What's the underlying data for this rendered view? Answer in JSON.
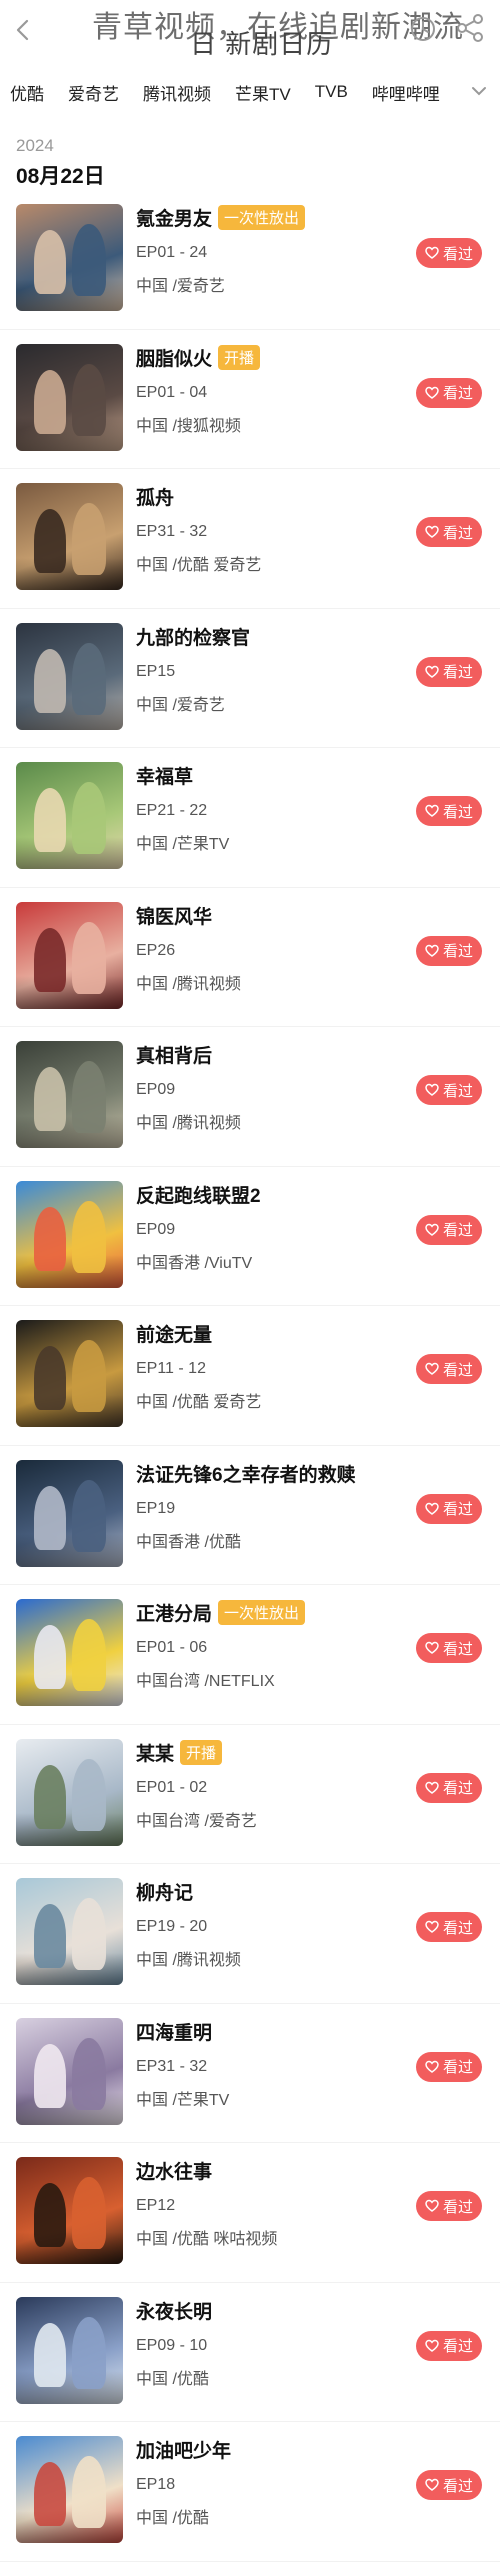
{
  "watermark": "青草视频，在线追剧新潮流",
  "header": {
    "title": "日 新剧日历"
  },
  "tabs": [
    "优酷",
    "爱奇艺",
    "腾讯视频",
    "芒果TV",
    "TVB",
    "哔哩哔哩"
  ],
  "year": "2024",
  "date": "08月22日",
  "watch_label": "看过",
  "items": [
    {
      "title": "氪金男友",
      "badge": "一次性放出",
      "episodes": "EP01 - 24",
      "region": "中国 /爱奇艺",
      "colors": [
        "#b98a6a",
        "#3c5a7a",
        "#d8c0a8"
      ]
    },
    {
      "title": "胭脂似火",
      "badge": "开播",
      "episodes": "EP01 - 04",
      "region": "中国 /搜狐视频",
      "colors": [
        "#2a2a2e",
        "#5a4a44",
        "#c9a890"
      ]
    },
    {
      "title": "孤舟",
      "badge": "",
      "episodes": "EP31 - 32",
      "region": "中国 /优酷 爱奇艺",
      "colors": [
        "#7a5a40",
        "#c8a070",
        "#3a2a20"
      ]
    },
    {
      "title": "九部的检察官",
      "badge": "",
      "episodes": "EP15",
      "region": "中国 /爱奇艺",
      "colors": [
        "#2c3440",
        "#5a6a7a",
        "#c0b8b0"
      ]
    },
    {
      "title": "幸福草",
      "badge": "",
      "episodes": "EP21 - 22",
      "region": "中国 /芒果TV",
      "colors": [
        "#5a8a4a",
        "#a8c878",
        "#e8d8b0"
      ]
    },
    {
      "title": "锦医风华",
      "badge": "",
      "episodes": "EP26",
      "region": "中国 /腾讯视频",
      "colors": [
        "#c83a3a",
        "#e8b0a0",
        "#7a2a2a"
      ]
    },
    {
      "title": "真相背后",
      "badge": "",
      "episodes": "EP09",
      "region": "中国 /腾讯视频",
      "colors": [
        "#3a4038",
        "#7a8070",
        "#c8c0a8"
      ]
    },
    {
      "title": "反起跑线联盟2",
      "badge": "",
      "episodes": "EP09",
      "region": "中国香港 /ViuTV",
      "colors": [
        "#3a8ad8",
        "#f0c040",
        "#e86040"
      ]
    },
    {
      "title": "前途无量",
      "badge": "",
      "episodes": "EP11 - 12",
      "region": "中国 /优酷 爱奇艺",
      "colors": [
        "#1a1a1a",
        "#c89a40",
        "#4a3a2a"
      ]
    },
    {
      "title": "法证先锋6之幸存者的救赎",
      "badge": "",
      "episodes": "EP19",
      "region": "中国香港 /优酷",
      "colors": [
        "#1a2a3a",
        "#4a6080",
        "#b0b8c8"
      ]
    },
    {
      "title": "正港分局",
      "badge": "一次性放出",
      "episodes": "EP01 - 06",
      "region": "中国台湾 /NETFLIX",
      "colors": [
        "#2a6ad0",
        "#f0d040",
        "#e8e8f0"
      ]
    },
    {
      "title": "某某",
      "badge": "开播",
      "episodes": "EP01 - 02",
      "region": "中国台湾 /爱奇艺",
      "colors": [
        "#e8ecf0",
        "#a8b8c8",
        "#6a8060"
      ]
    },
    {
      "title": "柳舟记",
      "badge": "",
      "episodes": "EP19 - 20",
      "region": "中国 /腾讯视频",
      "colors": [
        "#a8c8d8",
        "#e8e0d8",
        "#6a8aa0"
      ]
    },
    {
      "title": "四海重明",
      "badge": "",
      "episodes": "EP31 - 32",
      "region": "中国 /芒果TV",
      "colors": [
        "#d8d0e0",
        "#8a7aa0",
        "#f0e8f0"
      ]
    },
    {
      "title": "边水往事",
      "badge": "",
      "episodes": "EP12",
      "region": "中国 /优酷 咪咕视频",
      "colors": [
        "#7a2a1a",
        "#d86030",
        "#2a1a10"
      ]
    },
    {
      "title": "永夜长明",
      "badge": "",
      "episodes": "EP09 - 10",
      "region": "中国 /优酷",
      "colors": [
        "#2a3a5a",
        "#8aa0c8",
        "#e0e8f0"
      ]
    },
    {
      "title": "加油吧少年",
      "badge": "",
      "episodes": "EP18",
      "region": "中国 /优酷",
      "colors": [
        "#4a8ad0",
        "#f0e0c8",
        "#c84a40"
      ]
    }
  ]
}
